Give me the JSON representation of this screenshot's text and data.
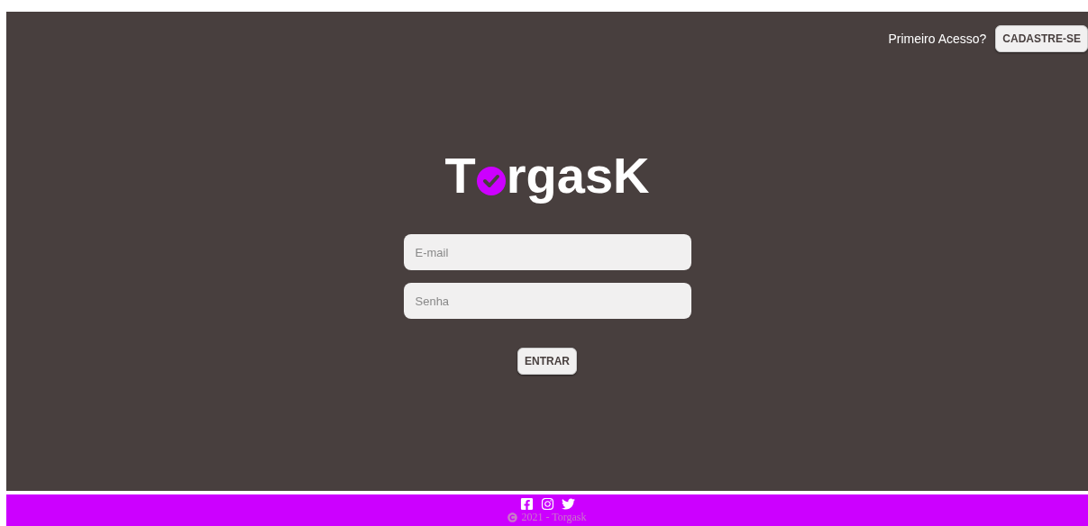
{
  "header": {
    "prompt": "Primeiro Acesso?",
    "signup_button": "CADASTRE-SE"
  },
  "logo": {
    "before": "T",
    "after": "rgasK"
  },
  "form": {
    "fields": [
      {
        "placeholder": "E-mail"
      },
      {
        "placeholder": "Senha"
      }
    ],
    "submit_button": "ENTRAR"
  },
  "footer": {
    "social": [
      {
        "kind": "facebook"
      },
      {
        "kind": "instagram"
      },
      {
        "kind": "twitter"
      }
    ],
    "copyright": "2021 - Torgask"
  }
}
